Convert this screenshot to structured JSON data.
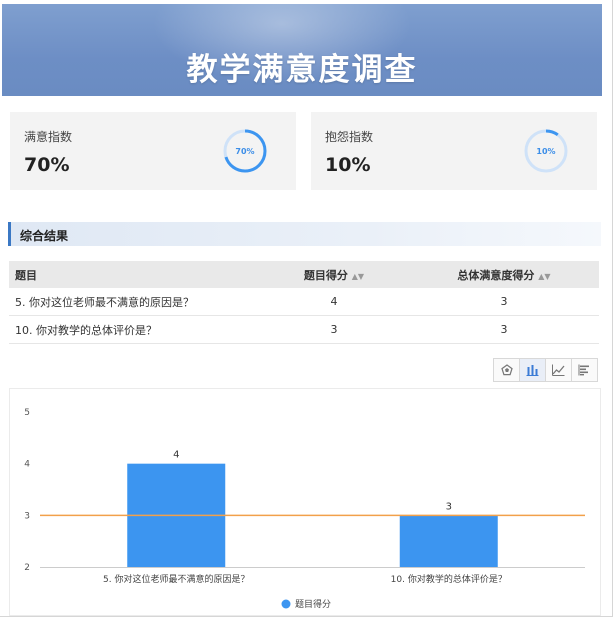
{
  "banner": {
    "title": "教学满意度调查"
  },
  "cards": [
    {
      "label": "满意指数",
      "value": "70%",
      "ring_label": "70%",
      "fraction": 0.7
    },
    {
      "label": "抱怨指数",
      "value": "10%",
      "ring_label": "10%",
      "fraction": 0.1
    }
  ],
  "section": {
    "title": "综合结果"
  },
  "table": {
    "headers": [
      "题目",
      "题目得分",
      "总体满意度得分"
    ],
    "rows": [
      {
        "question": "5. 你对这位老师最不满意的原因是？",
        "score": "4",
        "overall": "3"
      },
      {
        "question": "10. 你对教学的总体评价是？",
        "score": "3",
        "overall": "3"
      }
    ]
  },
  "toolbar": {
    "icons": [
      "pentagon-icon",
      "bar-chart-icon",
      "line-chart-icon",
      "horizontal-bar-icon"
    ],
    "active": 1
  },
  "colors": {
    "bar": "#3c95f0",
    "reference_line": "#f2a04a",
    "ring": "#3c95f0",
    "ring_track": "#cfe2f8"
  },
  "chart_data": {
    "type": "bar",
    "categories": [
      "5. 你对这位老师最不满意的原因是？",
      "10. 你对教学的总体评价是？"
    ],
    "series": [
      {
        "name": "题目得分",
        "values": [
          4,
          3
        ]
      }
    ],
    "ylim": [
      2,
      5
    ],
    "yticks": [
      2,
      3,
      4,
      5
    ],
    "reference_line": 3,
    "data_labels": [
      "4",
      "3"
    ],
    "legend": "bottom-center",
    "grid": false
  }
}
